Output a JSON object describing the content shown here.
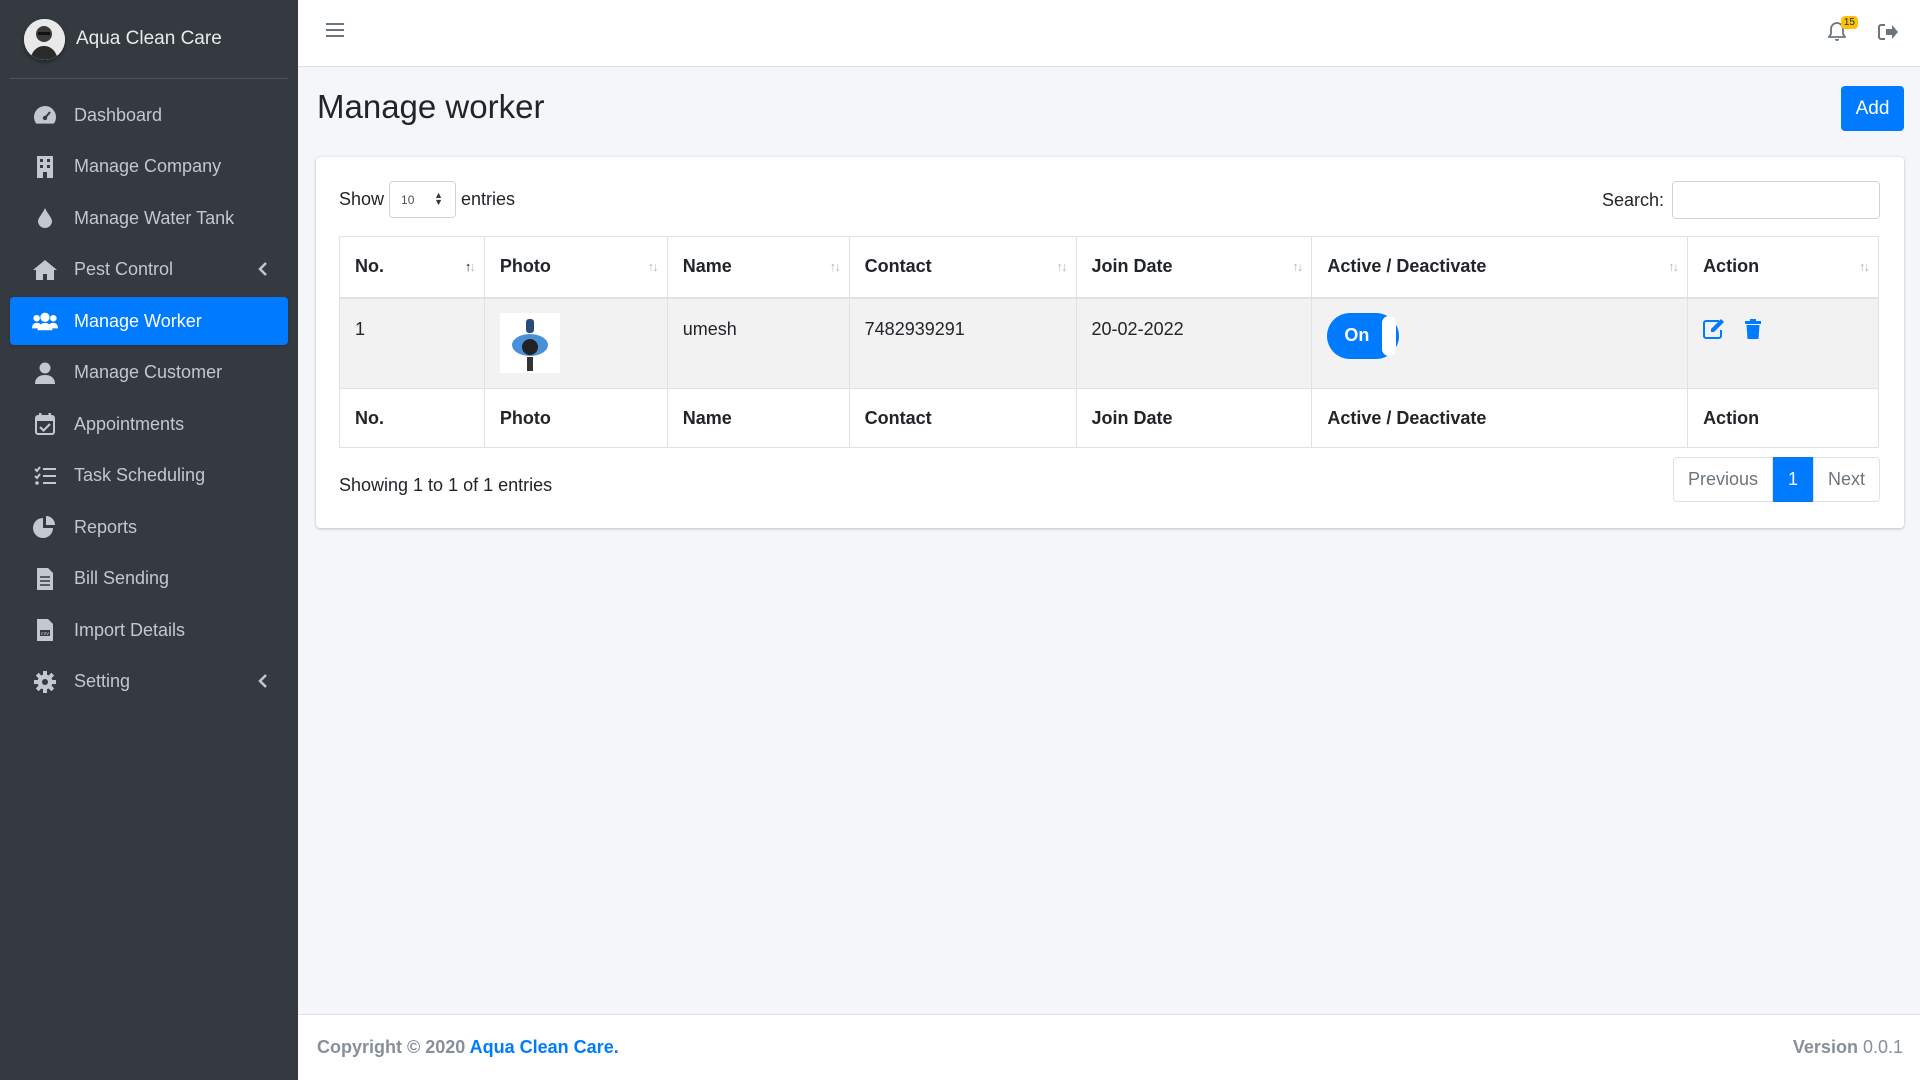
{
  "brand": {
    "name": "Aqua Clean Care"
  },
  "sidebar": {
    "items": [
      {
        "label": "Dashboard",
        "icon": "tachometer-icon"
      },
      {
        "label": "Manage Company",
        "icon": "building-icon"
      },
      {
        "label": "Manage Water Tank",
        "icon": "water-drop-icon"
      },
      {
        "label": "Pest Control",
        "icon": "home-icon",
        "has_submenu": true
      },
      {
        "label": "Manage Worker",
        "icon": "users-icon",
        "active": true
      },
      {
        "label": "Manage Customer",
        "icon": "user-icon"
      },
      {
        "label": "Appointments",
        "icon": "calendar-check-icon"
      },
      {
        "label": "Task Scheduling",
        "icon": "tasks-icon"
      },
      {
        "label": "Reports",
        "icon": "pie-chart-icon"
      },
      {
        "label": "Bill Sending",
        "icon": "file-invoice-icon"
      },
      {
        "label": "Import Details",
        "icon": "file-csv-icon"
      },
      {
        "label": "Setting",
        "icon": "gear-icon",
        "has_submenu": true
      }
    ]
  },
  "topbar": {
    "notification_count": "15"
  },
  "page": {
    "title": "Manage worker",
    "add_label": "Add"
  },
  "table_controls": {
    "show_label": "Show",
    "page_length": "10",
    "entries_label": "entries",
    "search_label": "Search:",
    "search_value": ""
  },
  "table": {
    "columns": [
      "No.",
      "Photo",
      "Name",
      "Contact",
      "Join Date",
      "Active / Deactivate",
      "Action"
    ],
    "rows": [
      {
        "no": "1",
        "name": "umesh",
        "contact": "7482939291",
        "join_date": "20-02-2022",
        "status": "On"
      }
    ]
  },
  "pagination": {
    "info": "Showing 1 to 1 of 1 entries",
    "previous": "Previous",
    "current": "1",
    "next": "Next"
  },
  "footer": {
    "copyright_prefix": "Copyright © 2020",
    "company": "Aqua Clean Care.",
    "version_label": "Version",
    "version": "0.0.1"
  },
  "colors": {
    "primary": "#007bff",
    "sidebar_bg": "#343a40",
    "badge": "#ffc107"
  }
}
